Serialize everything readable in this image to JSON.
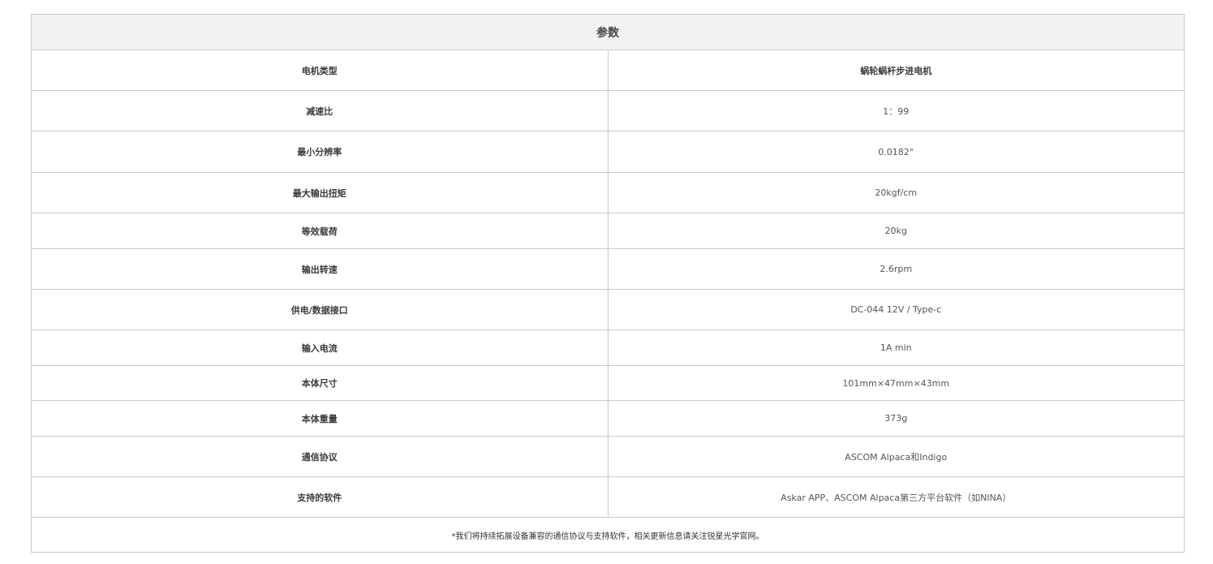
{
  "table": {
    "title": "参数",
    "rows": [
      {
        "label": "电机类型",
        "value": "蜗轮蜗杆步进电机"
      },
      {
        "label": "减速比",
        "value": "1：99"
      },
      {
        "label": "最小分辨率",
        "value": "0.0182°"
      },
      {
        "label": "最大输出扭矩",
        "value": "20kgf/cm"
      },
      {
        "label": "等效载荷",
        "value": "20kg"
      },
      {
        "label": "输出转速",
        "value": "2.6rpm"
      },
      {
        "label": "供电/数据接口",
        "value": "DC-044 12V / Type-c"
      },
      {
        "label": "输入电流",
        "value": "1A min"
      },
      {
        "label": "本体尺寸",
        "value": "101mm×47mm×43mm"
      },
      {
        "label": "本体重量",
        "value": "373g"
      },
      {
        "label": "通信协议",
        "value": "ASCOM Alpaca和Indigo"
      },
      {
        "label": "支持的软件",
        "value": "Askar APP、ASCOM Alpaca第三方平台软件（如NINA）"
      }
    ],
    "footnote": "*我们将持续拓展设备兼容的通信协议与支持软件，相关更新信息请关注锐星光学官网。"
  },
  "colors": {
    "border": "#c9c9c9",
    "header_bg": "#f2f2f2",
    "text": "#333333"
  }
}
